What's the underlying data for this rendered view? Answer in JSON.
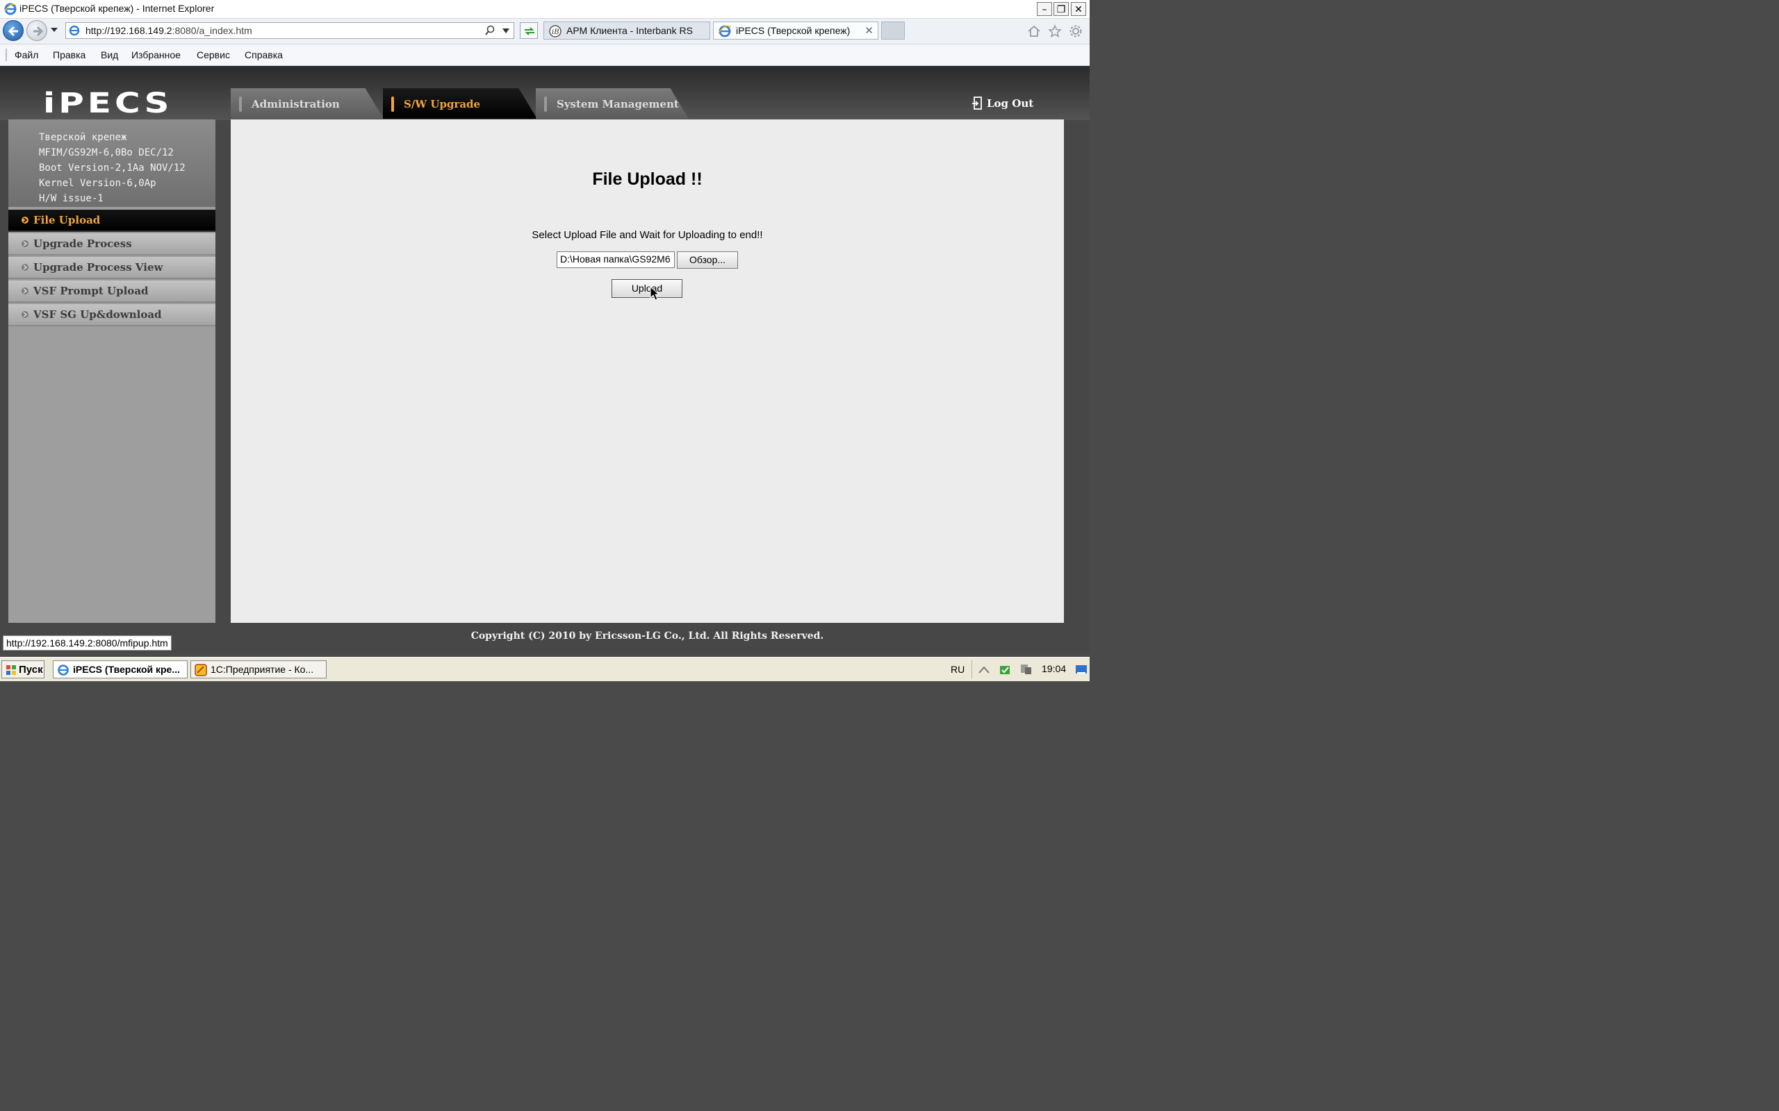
{
  "window": {
    "title": "iPECS (Тверской крепеж) - Internet Explorer",
    "minimize": "–",
    "restore": "❐",
    "close": "✕"
  },
  "browser": {
    "url_host": "http://192.168.149.2",
    "url_rest": ":8080/a_index.htm",
    "tabs": [
      {
        "label": "АРМ Клиента - Interbank RS"
      },
      {
        "label": "iPECS (Тверской крепеж)",
        "close": "✕"
      }
    ],
    "menu": [
      "Файл",
      "Правка",
      "Вид",
      "Избранное",
      "Сервис",
      "Справка"
    ],
    "status_url": "http://192.168.149.2:8080/mfipup.htm"
  },
  "app": {
    "logo": "iPECS",
    "nav_tabs": [
      "Administration",
      "S/W Upgrade",
      "System Management"
    ],
    "logout": "Log Out",
    "system_info": [
      "Тверской крепеж",
      "MFIM/GS92M-6,0Bo DEC/12",
      "Boot Version-2,1Aa NOV/12",
      "Kernel Version-6,0Ap",
      "H/W issue-1"
    ],
    "sidebar": [
      {
        "label": "File Upload"
      },
      {
        "label": "Upgrade Process"
      },
      {
        "label": "Upgrade Process View"
      },
      {
        "label": "VSF Prompt Upload"
      },
      {
        "label": "VSF SG Up&download"
      }
    ],
    "main": {
      "heading": "File Upload !!",
      "instruction": "Select Upload File and Wait for Uploading to end!!",
      "file_value": "D:\\Новая папка\\GS92M6",
      "browse_label": "Обзор...",
      "upload_label": "Upload"
    },
    "footer": "Copyright (C) 2010 by Ericsson-LG Co., Ltd. All Rights Reserved."
  },
  "taskbar": {
    "start": "Пуск",
    "tasks": [
      "iPECS (Тверской кре...",
      "1С:Предприятие - Ко..."
    ],
    "lang": "RU",
    "clock": "19:04"
  },
  "colors": {
    "active_orange": "#f2a53a",
    "page_bg": "#474747",
    "content_bg": "#ececec"
  }
}
